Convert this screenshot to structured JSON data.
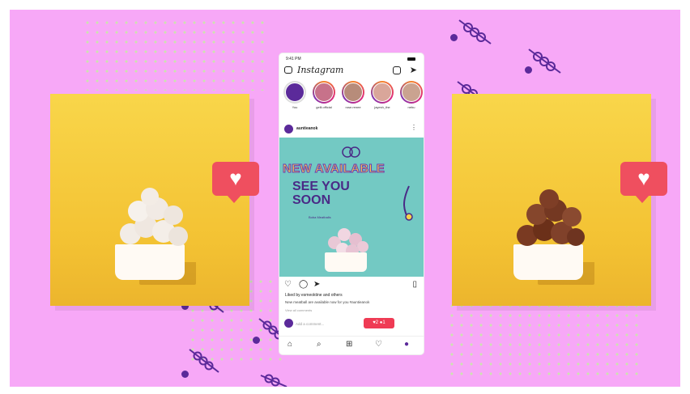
{
  "colors": {
    "background": "#f7a8f7",
    "accent_heart": "#ef4f5f",
    "photo_yellow": "#f3c233",
    "purple": "#5b2a9a",
    "teal_post": "#73c9c3"
  },
  "phone": {
    "status_time": "9:41 PM",
    "app_name": "Instagram",
    "stories": [
      {
        "label": "You"
      },
      {
        "label": "gelli.official"
      },
      {
        "label": "rose.renee"
      },
      {
        "label": "jayesh_the"
      },
      {
        "label": "nebu"
      }
    ],
    "post_user": "auntieanok",
    "post_headline": "NEW AVAILABLE",
    "post_subheadline_line1": "SEE YOU",
    "post_subheadline_line2": "SOON",
    "post_product_label": "Boba Meatballs",
    "likes_text": "Liked by esmeoktine and others",
    "caption_text": "New meatball are available now for you #auntieanok",
    "view_comments": "View all comments",
    "add_comment": "Add a comment...",
    "notification": "♥2  ●1"
  },
  "icons": {
    "heart_bubble_left": "heart-icon",
    "heart_bubble_right": "heart-icon"
  }
}
